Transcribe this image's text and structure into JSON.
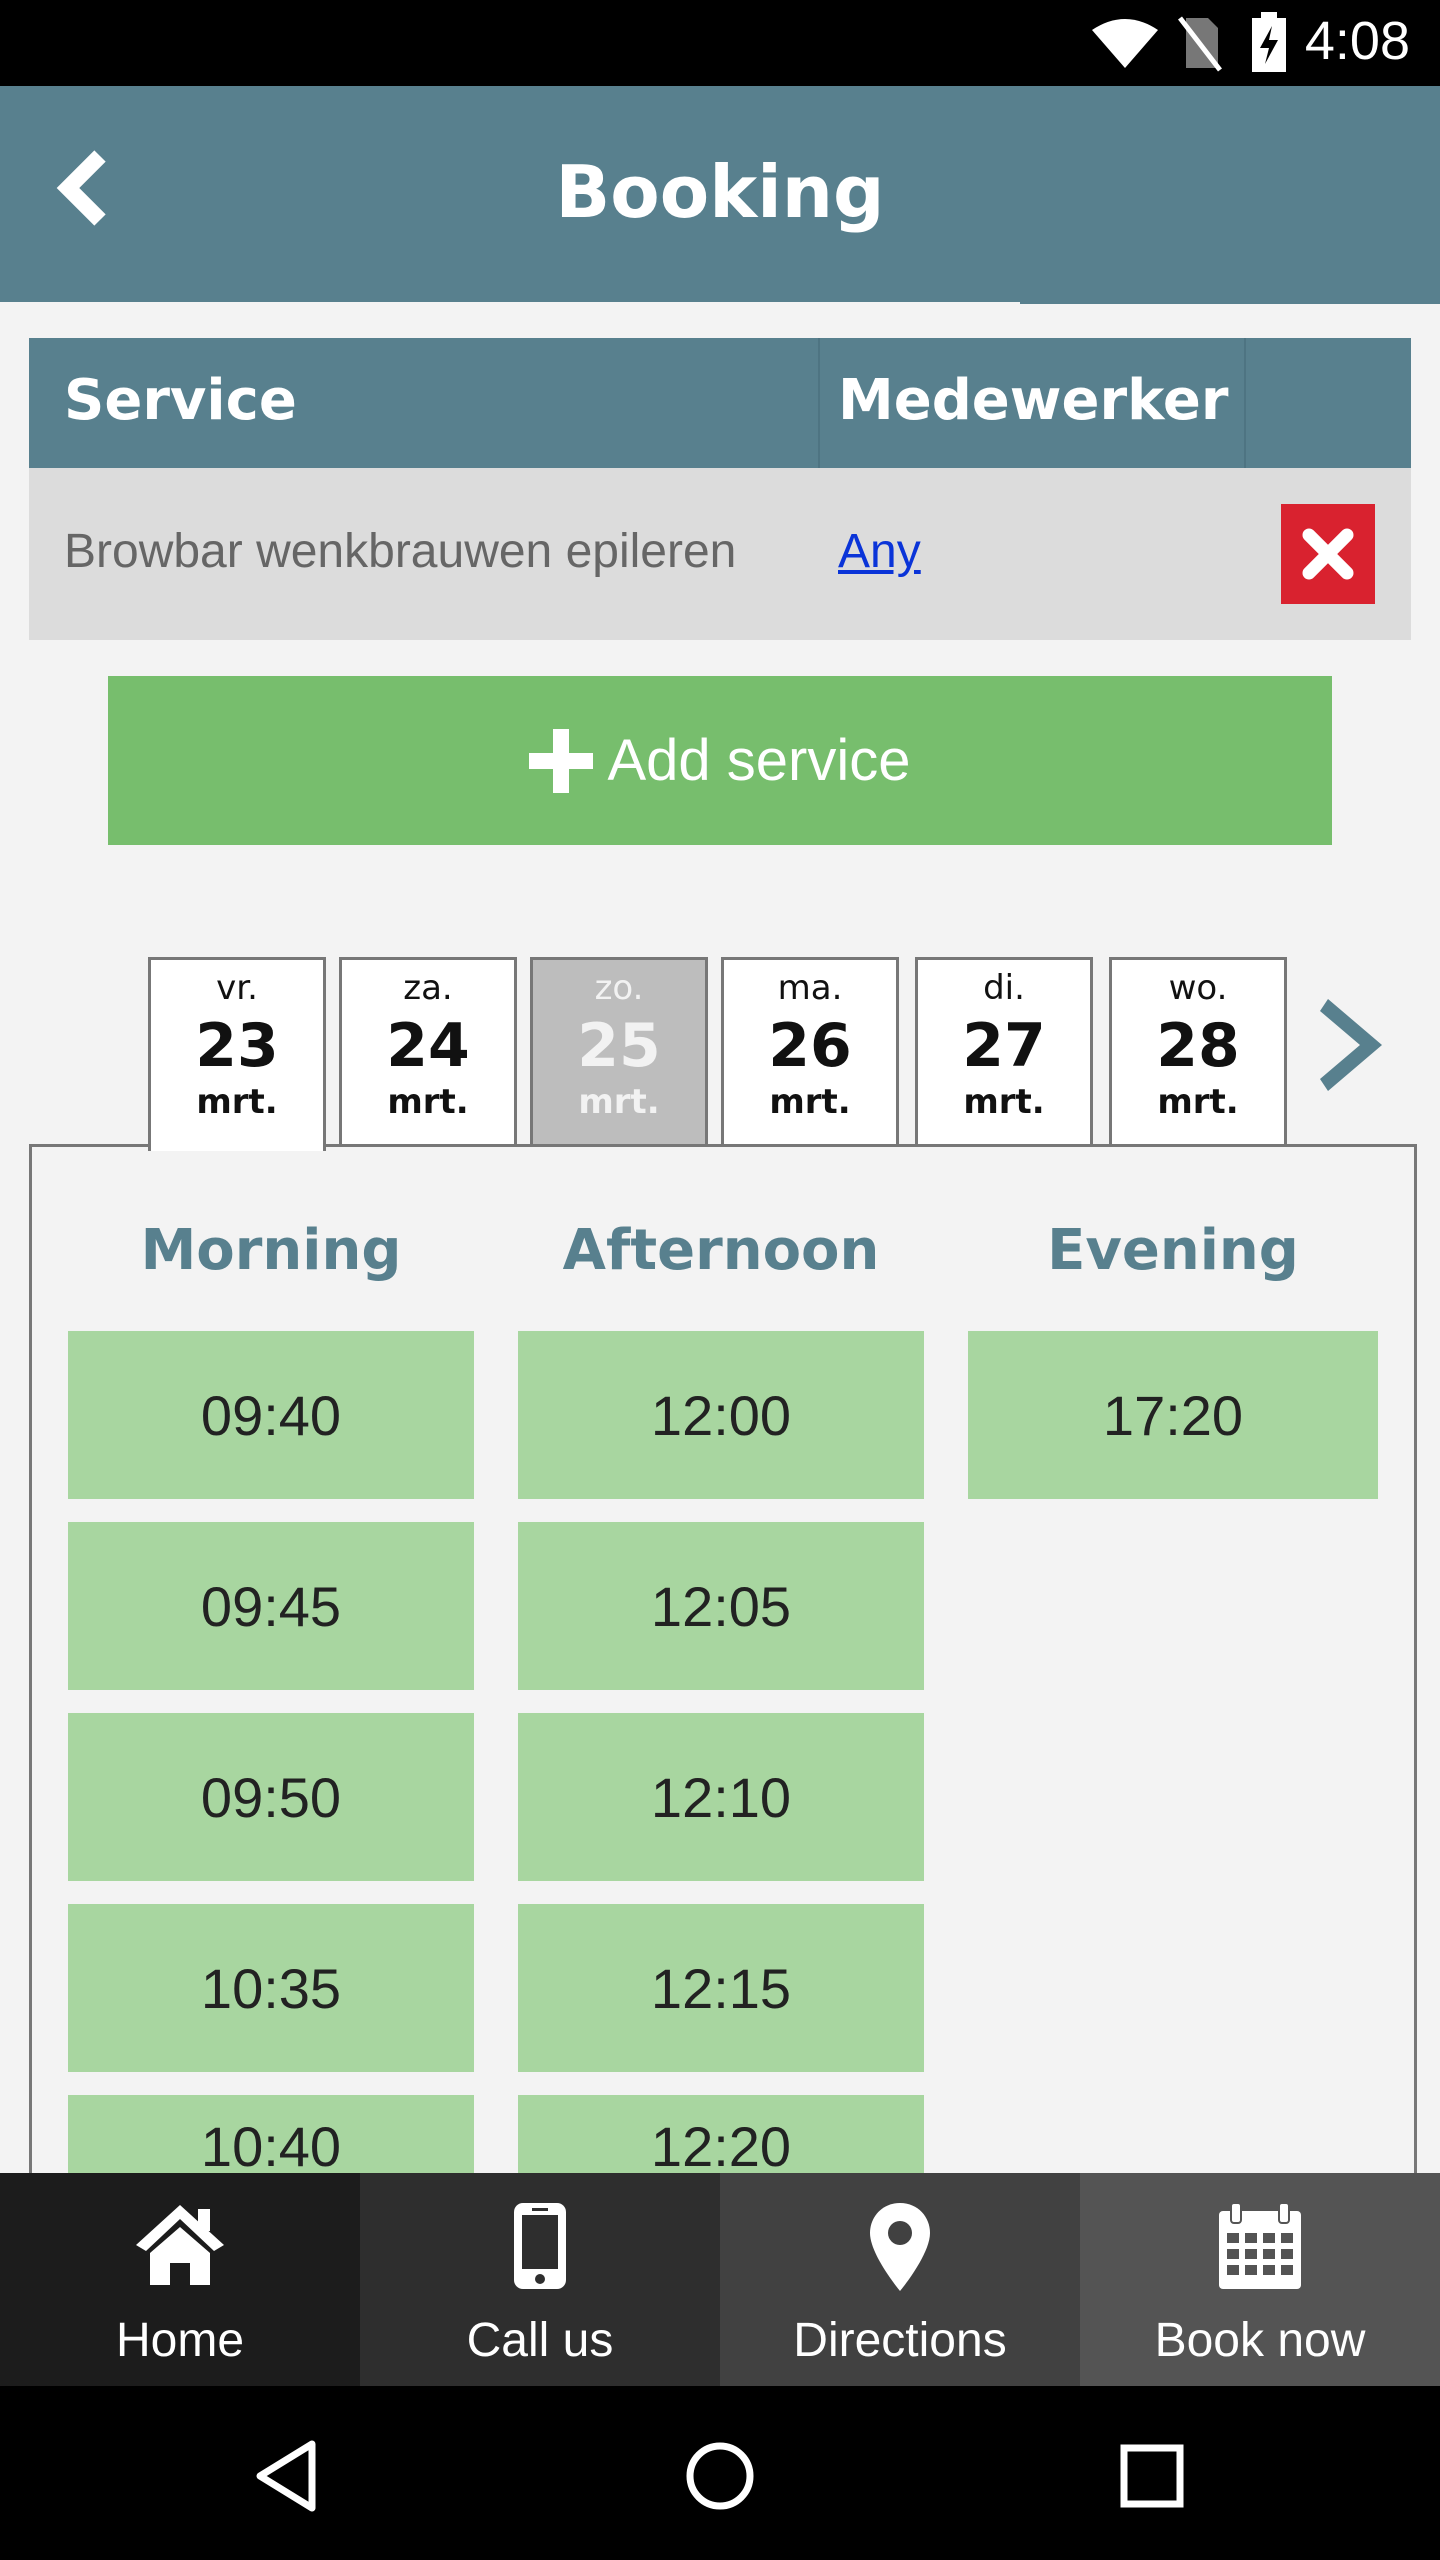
{
  "status_bar": {
    "time": "4:08"
  },
  "app_bar": {
    "title": "Booking"
  },
  "service_table": {
    "headers": {
      "service": "Service",
      "staff": "Medewerker"
    },
    "rows": [
      {
        "service": "Browbar wenkbrauwen epileren",
        "staff": "Any"
      }
    ]
  },
  "add_service": {
    "label": "Add service"
  },
  "dates": [
    {
      "dow": "vr.",
      "day": "23",
      "month": "mrt."
    },
    {
      "dow": "za.",
      "day": "24",
      "month": "mrt."
    },
    {
      "dow": "zo.",
      "day": "25",
      "month": "mrt."
    },
    {
      "dow": "ma.",
      "day": "26",
      "month": "mrt."
    },
    {
      "dow": "di.",
      "day": "27",
      "month": "mrt."
    },
    {
      "dow": "wo.",
      "day": "28",
      "month": "mrt."
    }
  ],
  "selected_date_index": 0,
  "disabled_date_index": 2,
  "time_slots": {
    "morning": {
      "heading": "Morning",
      "times": [
        "09:40",
        "09:45",
        "09:50",
        "10:35",
        "10:40"
      ]
    },
    "afternoon": {
      "heading": "Afternoon",
      "times": [
        "12:00",
        "12:05",
        "12:10",
        "12:15",
        "12:20"
      ]
    },
    "evening": {
      "heading": "Evening",
      "times": [
        "17:20"
      ]
    }
  },
  "bottom_nav": [
    {
      "label": "Home",
      "icon": "home-icon"
    },
    {
      "label": "Call us",
      "icon": "phone-icon"
    },
    {
      "label": "Directions",
      "icon": "map-pin-icon"
    },
    {
      "label": "Book now",
      "icon": "calendar-icon"
    }
  ],
  "colors": {
    "header": "#58808e",
    "add_button": "#77be6d",
    "slot": "#a8d6a0",
    "remove": "#d9222f"
  }
}
